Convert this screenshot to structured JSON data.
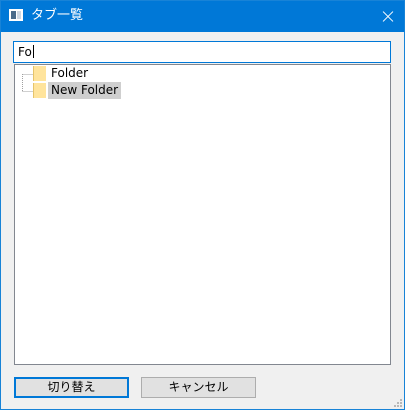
{
  "window": {
    "title": "タブ一覧",
    "icon": "app-window-icon",
    "close_icon": "close-icon"
  },
  "search": {
    "value": "Fo"
  },
  "tree": {
    "items": [
      {
        "label": "Folder",
        "icon": "folder-icon",
        "selected": false
      },
      {
        "label": "New Folder",
        "icon": "folder-icon",
        "selected": true
      }
    ]
  },
  "buttons": {
    "switch_label": "切り替え",
    "cancel_label": "キャンセル"
  },
  "colors": {
    "titlebar": "#0078d7",
    "selection": "#cfcfcf",
    "folder": "#ffe49c"
  }
}
